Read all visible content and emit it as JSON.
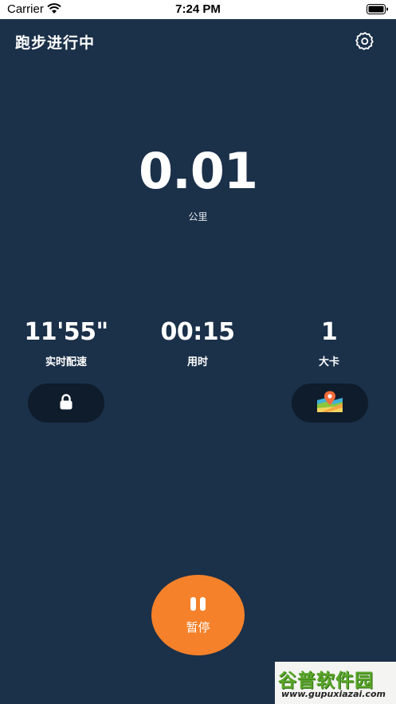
{
  "status_bar": {
    "carrier": "Carrier",
    "time": "7:24 PM"
  },
  "header": {
    "title": "跑步进行中",
    "settings_icon": "gear-icon"
  },
  "distance": {
    "value": "0.01",
    "unit": "公里"
  },
  "stats": [
    {
      "value": "11'55\"",
      "label": "实时配速"
    },
    {
      "value": "00:15",
      "label": "用时"
    },
    {
      "value": "1",
      "label": "大卡"
    }
  ],
  "actions": {
    "lock_icon": "lock-icon",
    "map_icon": "map-icon"
  },
  "pause": {
    "label": "暂停",
    "icon": "pause-icon"
  },
  "watermark": {
    "title": "谷普软件园",
    "url": "www.gupuxiazai.com"
  },
  "colors": {
    "background": "#1b3049",
    "accent": "#f5812a",
    "pill": "#0e1c2b"
  }
}
